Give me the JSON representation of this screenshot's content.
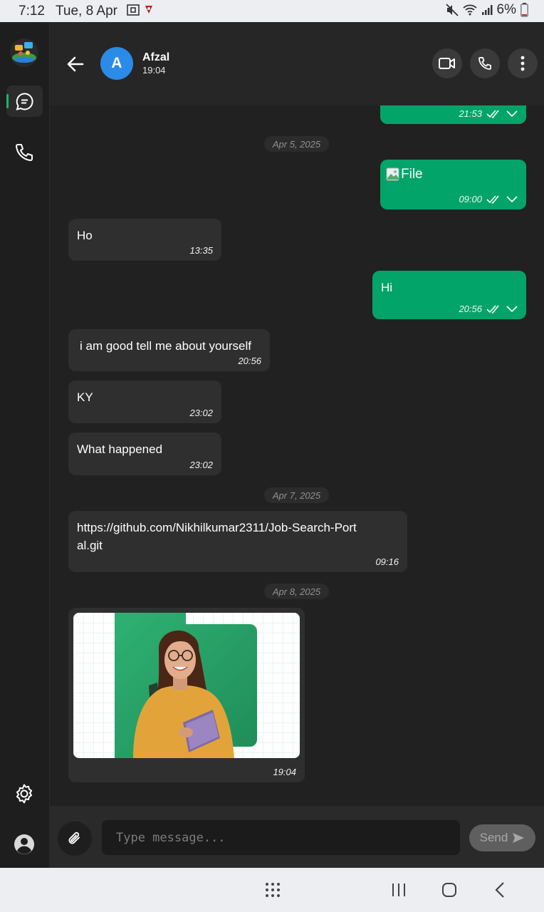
{
  "status_bar": {
    "time": "7:12",
    "date": "Tue, 8 Apr",
    "battery": "6%"
  },
  "header": {
    "avatar_letter": "A",
    "contact_name": "Afzal",
    "last_seen": "19:04"
  },
  "messages": {
    "m0": {
      "time": "21:53"
    },
    "d1": "Apr 5, 2025",
    "m1": {
      "text": "File",
      "time": "09:00"
    },
    "m2": {
      "text": "Ho",
      "time": "13:35"
    },
    "m3": {
      "text": "Hi",
      "time": "20:56"
    },
    "m4": {
      "text": "i am good tell me about yourself",
      "time": "20:56"
    },
    "m5": {
      "text": "KY",
      "time": "23:02"
    },
    "m6": {
      "text": "What happened",
      "time": "23:02"
    },
    "d2": "Apr 7, 2025",
    "m7": {
      "text": "https://github.com/Nikhilkumar2311/Job-Search-Portal.git",
      "time": "09:16"
    },
    "d3": "Apr 8, 2025",
    "m8": {
      "time": "19:04"
    }
  },
  "input": {
    "placeholder": "Type message...",
    "send_label": "Send"
  },
  "colors": {
    "outgoing": "#03a46a",
    "incoming": "#2f2f2f",
    "accent_blue": "#2a8be8",
    "rail_indicator": "#1db46c"
  },
  "icons": [
    "back-arrow-icon",
    "video-icon",
    "phone-icon",
    "more-vertical-icon",
    "chat-icon",
    "settings-icon",
    "profile-icon",
    "attach-icon",
    "send-icon",
    "broken-image-icon",
    "double-check-icon",
    "chevron-down-icon"
  ]
}
